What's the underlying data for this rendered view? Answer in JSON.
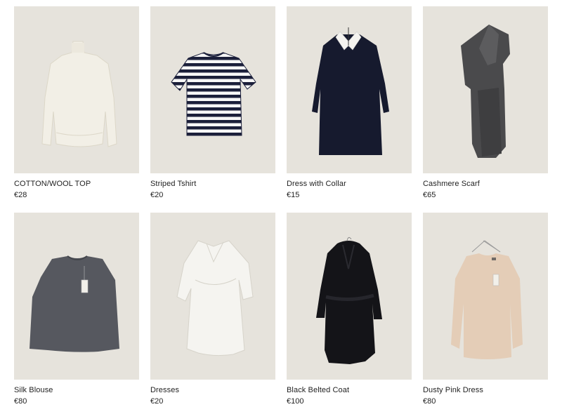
{
  "products": [
    {
      "name": "COTTON/WOOL TOP",
      "price": "€28",
      "image": "cream-turtleneck-sweater"
    },
    {
      "name": "Striped Tshirt",
      "price": "€20",
      "image": "navy-striped-tshirt"
    },
    {
      "name": "Dress with Collar",
      "price": "€15",
      "image": "navy-dress-white-collar"
    },
    {
      "name": "Cashmere Scarf",
      "price": "€65",
      "image": "grey-cashmere-scarf"
    },
    {
      "name": "Silk Blouse",
      "price": "€80",
      "image": "grey-silk-blouse"
    },
    {
      "name": "Dresses",
      "price": "€20",
      "image": "white-wrap-dress"
    },
    {
      "name": "Black Belted Coat",
      "price": "€100",
      "image": "black-belted-coat"
    },
    {
      "name": "Dusty Pink Dress",
      "price": "€80",
      "image": "dusty-pink-dress"
    }
  ],
  "colors": {
    "image_background": "#e6e3dc",
    "text": "#222222"
  }
}
